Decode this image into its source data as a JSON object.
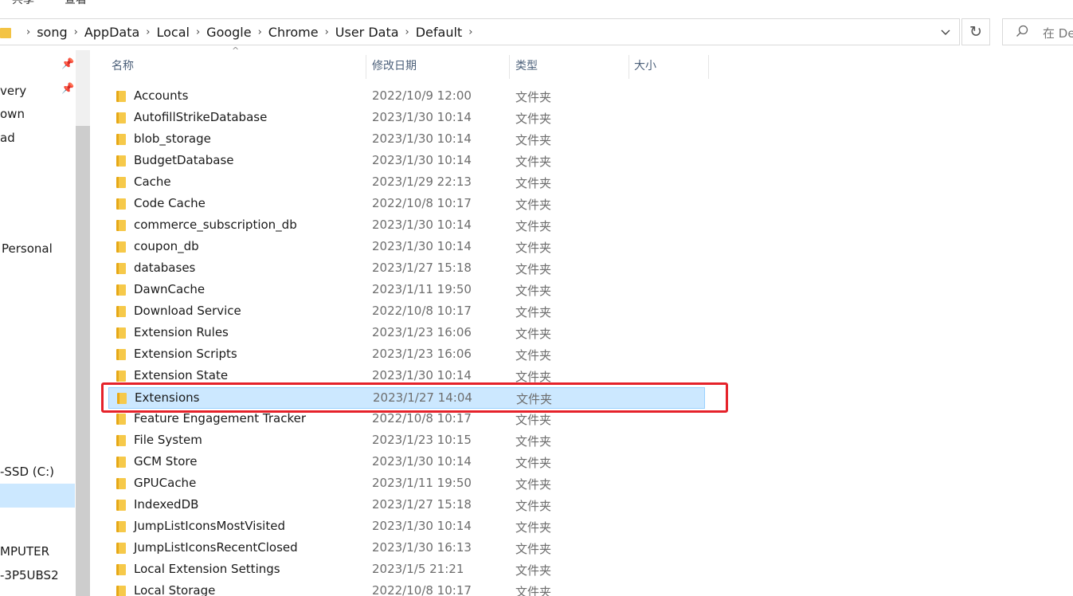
{
  "ribbon": {
    "tabs": [
      "共享",
      "查看"
    ]
  },
  "address": {
    "crumbs": [
      "song",
      "AppData",
      "Local",
      "Google",
      "Chrome",
      "User Data",
      "Default"
    ],
    "separator": "›",
    "search_placeholder": "在 De"
  },
  "nav": {
    "items": [
      "very",
      "own",
      "ad",
      "Personal",
      "-SSD (C:)",
      "MPUTER",
      "-3P5UBS2"
    ]
  },
  "columns": {
    "name": "名称",
    "date": "修改日期",
    "type": "类型",
    "size": "大小"
  },
  "files": [
    {
      "name": "Accounts",
      "date": "2022/10/9 12:00",
      "type": "文件夹"
    },
    {
      "name": "AutofillStrikeDatabase",
      "date": "2023/1/30 10:14",
      "type": "文件夹"
    },
    {
      "name": "blob_storage",
      "date": "2023/1/30 10:14",
      "type": "文件夹"
    },
    {
      "name": "BudgetDatabase",
      "date": "2023/1/30 10:14",
      "type": "文件夹"
    },
    {
      "name": "Cache",
      "date": "2023/1/29 22:13",
      "type": "文件夹"
    },
    {
      "name": "Code Cache",
      "date": "2022/10/8 10:17",
      "type": "文件夹"
    },
    {
      "name": "commerce_subscription_db",
      "date": "2023/1/30 10:14",
      "type": "文件夹"
    },
    {
      "name": "coupon_db",
      "date": "2023/1/30 10:14",
      "type": "文件夹"
    },
    {
      "name": "databases",
      "date": "2023/1/27 15:18",
      "type": "文件夹"
    },
    {
      "name": "DawnCache",
      "date": "2023/1/11 19:50",
      "type": "文件夹"
    },
    {
      "name": "Download Service",
      "date": "2022/10/8 10:17",
      "type": "文件夹"
    },
    {
      "name": "Extension Rules",
      "date": "2023/1/23 16:06",
      "type": "文件夹"
    },
    {
      "name": "Extension Scripts",
      "date": "2023/1/23 16:06",
      "type": "文件夹"
    },
    {
      "name": "Extension State",
      "date": "2023/1/30 10:14",
      "type": "文件夹"
    },
    {
      "name": "Extensions",
      "date": "2023/1/27 14:04",
      "type": "文件夹",
      "selected": true
    },
    {
      "name": "Feature Engagement Tracker",
      "date": "2022/10/8 10:17",
      "type": "文件夹"
    },
    {
      "name": "File System",
      "date": "2023/1/23 10:15",
      "type": "文件夹"
    },
    {
      "name": "GCM Store",
      "date": "2023/1/30 10:14",
      "type": "文件夹"
    },
    {
      "name": "GPUCache",
      "date": "2023/1/11 19:50",
      "type": "文件夹"
    },
    {
      "name": "IndexedDB",
      "date": "2023/1/27 15:18",
      "type": "文件夹"
    },
    {
      "name": "JumpListIconsMostVisited",
      "date": "2023/1/30 10:14",
      "type": "文件夹"
    },
    {
      "name": "JumpListIconsRecentClosed",
      "date": "2023/1/30 16:13",
      "type": "文件夹"
    },
    {
      "name": "Local Extension Settings",
      "date": "2023/1/5 21:21",
      "type": "文件夹"
    },
    {
      "name": "Local Storage",
      "date": "2022/10/8 10:17",
      "type": "文件夹"
    }
  ]
}
